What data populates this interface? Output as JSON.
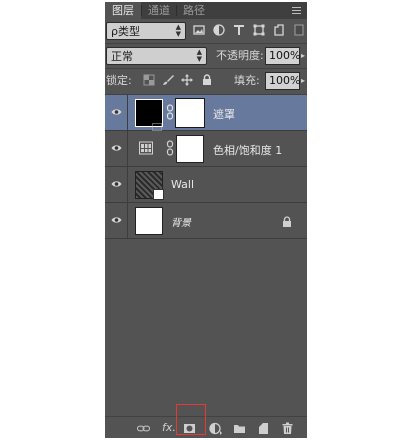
{
  "tabs": [
    {
      "label": "图层",
      "active": true
    },
    {
      "label": "通道",
      "active": false
    },
    {
      "label": "路径",
      "active": false
    }
  ],
  "filter": {
    "label": "ρ类型",
    "icons": [
      "image-filter-icon",
      "adjustment-filter-icon",
      "type-filter-icon",
      "shape-filter-icon",
      "smart-object-filter-icon"
    ]
  },
  "blend": {
    "mode": "正常",
    "opacity_label": "不透明度:",
    "opacity_value": "100%"
  },
  "lock": {
    "label": "锁定:",
    "fill_label": "填充:",
    "fill_value": "100%"
  },
  "layers": [
    {
      "name": "遮罩",
      "selected": true
    },
    {
      "name": "色相/饱和度 1",
      "selected": false
    },
    {
      "name": "Wall",
      "selected": false
    },
    {
      "name": "背景",
      "selected": false
    }
  ],
  "colors": {
    "panel_bg": "#535353",
    "selected": "#67799c",
    "highlight": "#e53935"
  }
}
